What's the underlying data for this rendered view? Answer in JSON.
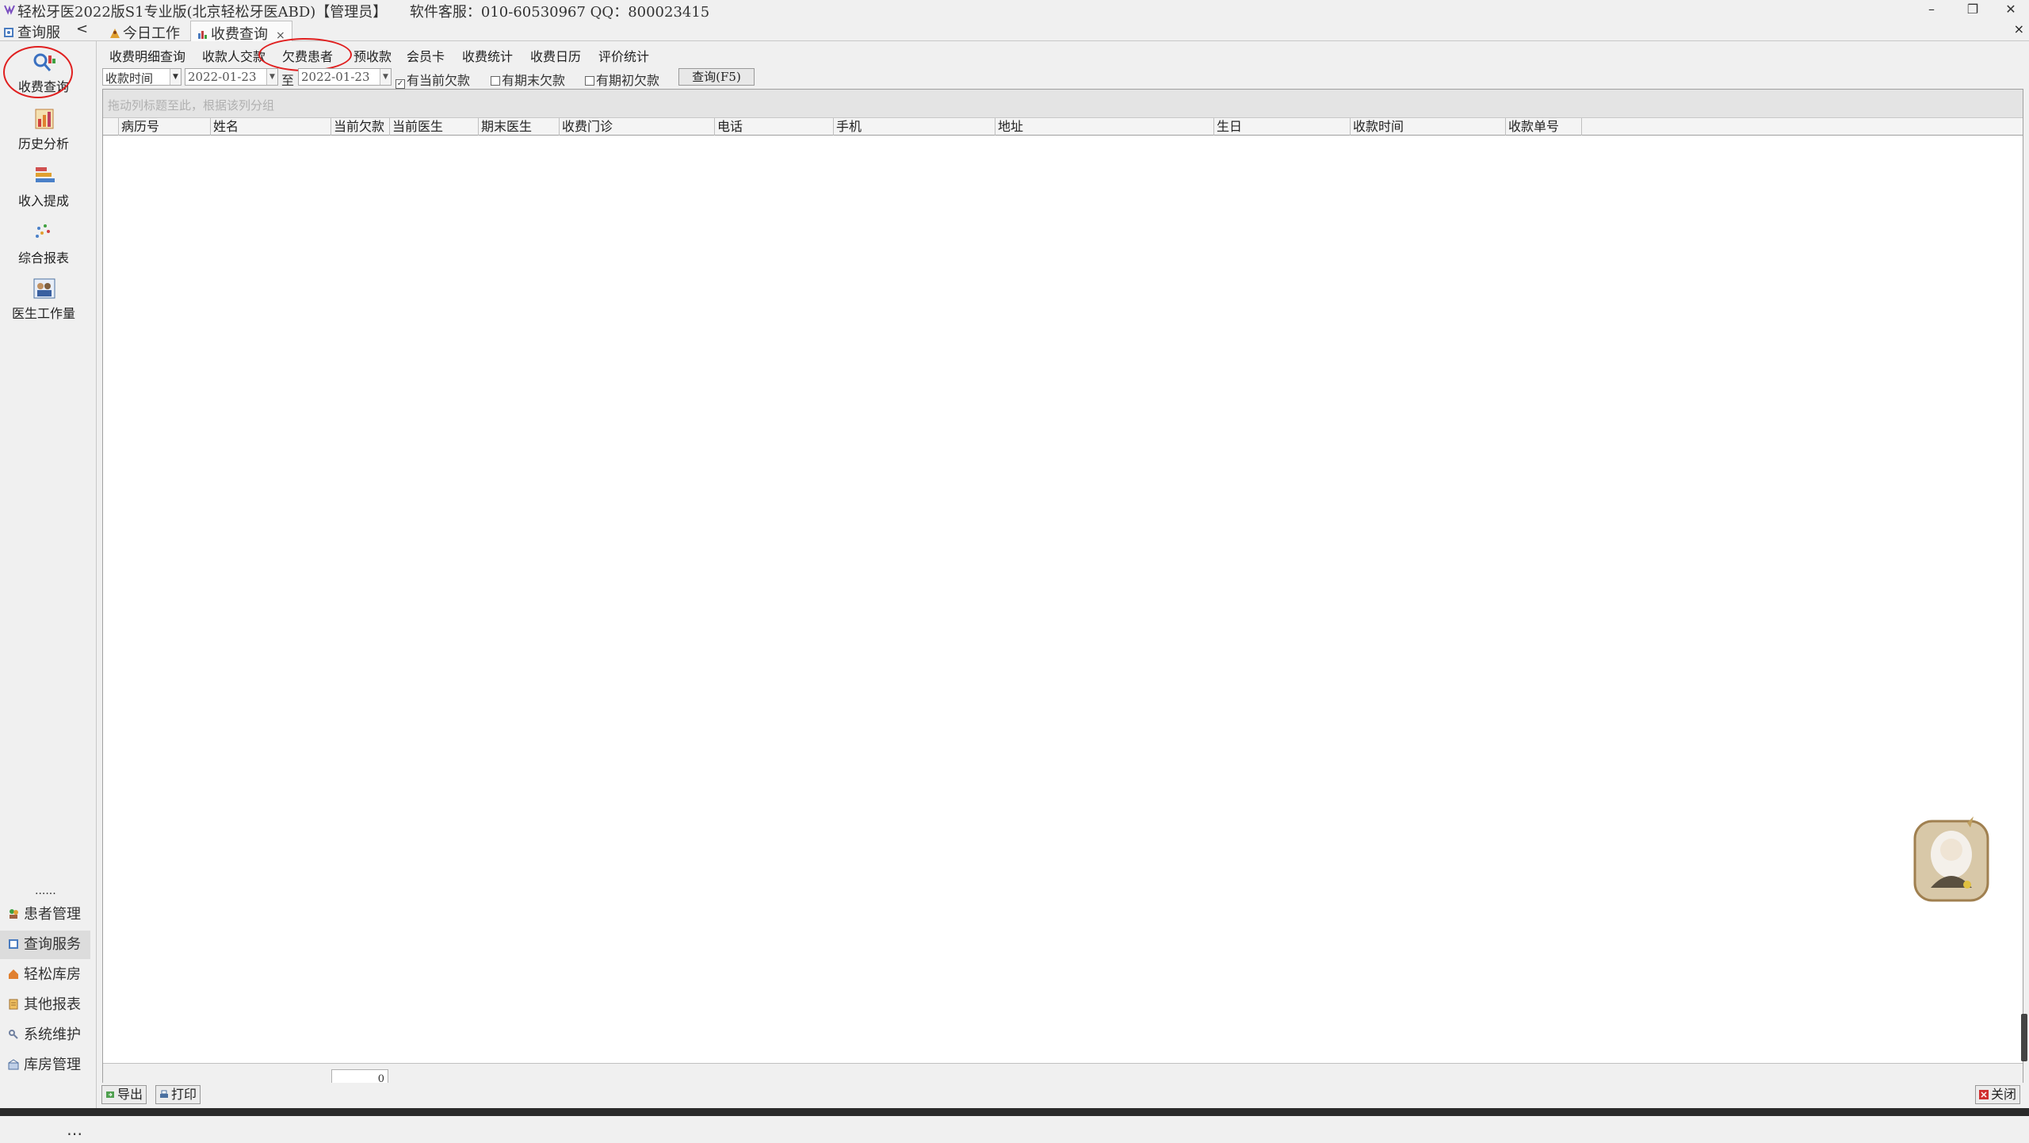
{
  "window": {
    "title": "轻松牙医2022版S1专业版(北京轻松牙医ABD)【管理员】     软件客服：010-60530967 QQ：800023415",
    "minimize": "–",
    "restore": "❐",
    "close": "✕"
  },
  "tabs": {
    "nav_header": "查询服",
    "collapse": "<",
    "items": [
      {
        "label": "今日工作"
      },
      {
        "label": "收费查询",
        "close": "×"
      }
    ],
    "close_all": "×"
  },
  "sidebar": {
    "items": [
      {
        "label": "收费查询",
        "icon": "charge-query-icon"
      },
      {
        "label": "历史分析",
        "icon": "history-analysis-icon"
      },
      {
        "label": "收入提成",
        "icon": "income-commission-icon"
      },
      {
        "label": "综合报表",
        "icon": "comprehensive-report-icon"
      },
      {
        "label": "医生工作量",
        "icon": "doctor-workload-icon"
      }
    ],
    "dots": "......",
    "modules": [
      {
        "label": "患者管理"
      },
      {
        "label": "查询服务"
      },
      {
        "label": "轻松库房"
      },
      {
        "label": "其他报表"
      },
      {
        "label": "系统维护"
      },
      {
        "label": "库房管理"
      }
    ],
    "more": "⋯"
  },
  "subtabs": [
    "收费明细查询",
    "收款人交款",
    "欠费患者",
    "预收款",
    "会员卡",
    "收费统计",
    "收费日历",
    "评价统计"
  ],
  "filter": {
    "time_type": "收款时间",
    "date_from": "2022-01-23",
    "to_label": "至",
    "date_to": "2022-01-23",
    "chk_current": "有当前欠款",
    "chk_end": "有期末欠款",
    "chk_begin": "有期初欠款",
    "query_button": "查询(F5)"
  },
  "grid": {
    "group_hint": "拖动列标题至此，根据该列分组",
    "columns": [
      "病历号",
      "姓名",
      "当前欠款",
      "当前医生",
      "期末医生",
      "收费门诊",
      "电话",
      "手机",
      "地址",
      "生日",
      "收款时间",
      "收款单号"
    ],
    "rows": [],
    "sum_current_debt": "0"
  },
  "bottom": {
    "export": "导出",
    "print": "打印",
    "close": "关闭"
  },
  "colors": {
    "highlight_circle": "#e02020",
    "background": "#f0f0f0"
  }
}
